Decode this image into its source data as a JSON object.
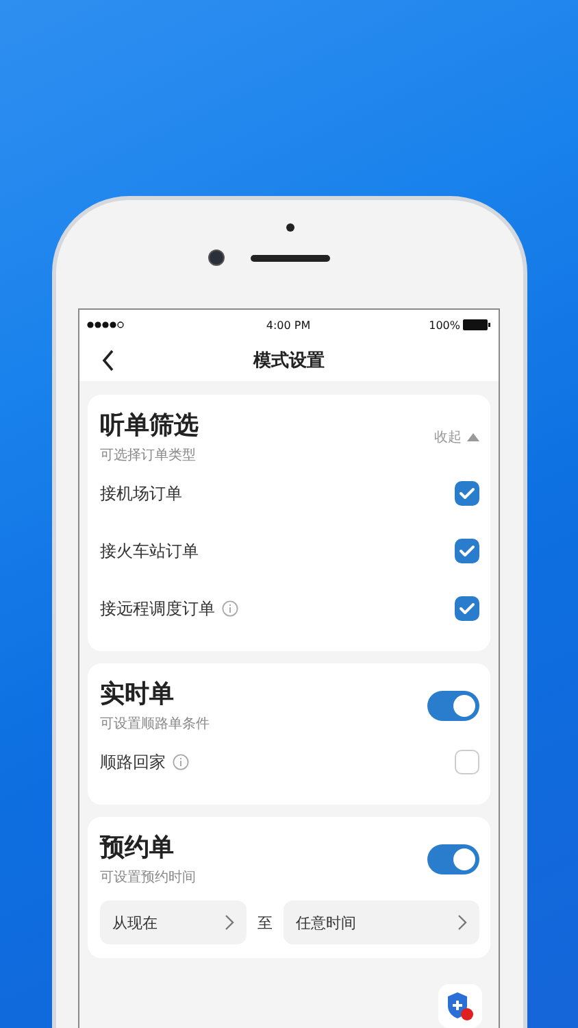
{
  "status_bar": {
    "time": "4:00 PM",
    "battery": "100%"
  },
  "nav": {
    "title": "模式设置"
  },
  "sections": [
    {
      "kind": "filter",
      "title": "听单筛选",
      "subtitle": "可选择订单类型",
      "collapse": "收起",
      "options": [
        {
          "label": "接机场订单",
          "info": false,
          "checked": true
        },
        {
          "label": "接火车站订单",
          "info": false,
          "checked": true
        },
        {
          "label": "接远程调度订单",
          "info": true,
          "checked": true
        }
      ]
    },
    {
      "kind": "toggle",
      "title": "实时单",
      "subtitle": "可设置顺路单条件",
      "on": true,
      "options": [
        {
          "label": "顺路回家",
          "info": true,
          "checked": false
        }
      ]
    },
    {
      "kind": "toggle",
      "title": "预约单",
      "subtitle": "可设置预约时间",
      "on": true,
      "range": {
        "from": "从现在",
        "separator": "至",
        "to": "任意时间"
      }
    }
  ]
}
